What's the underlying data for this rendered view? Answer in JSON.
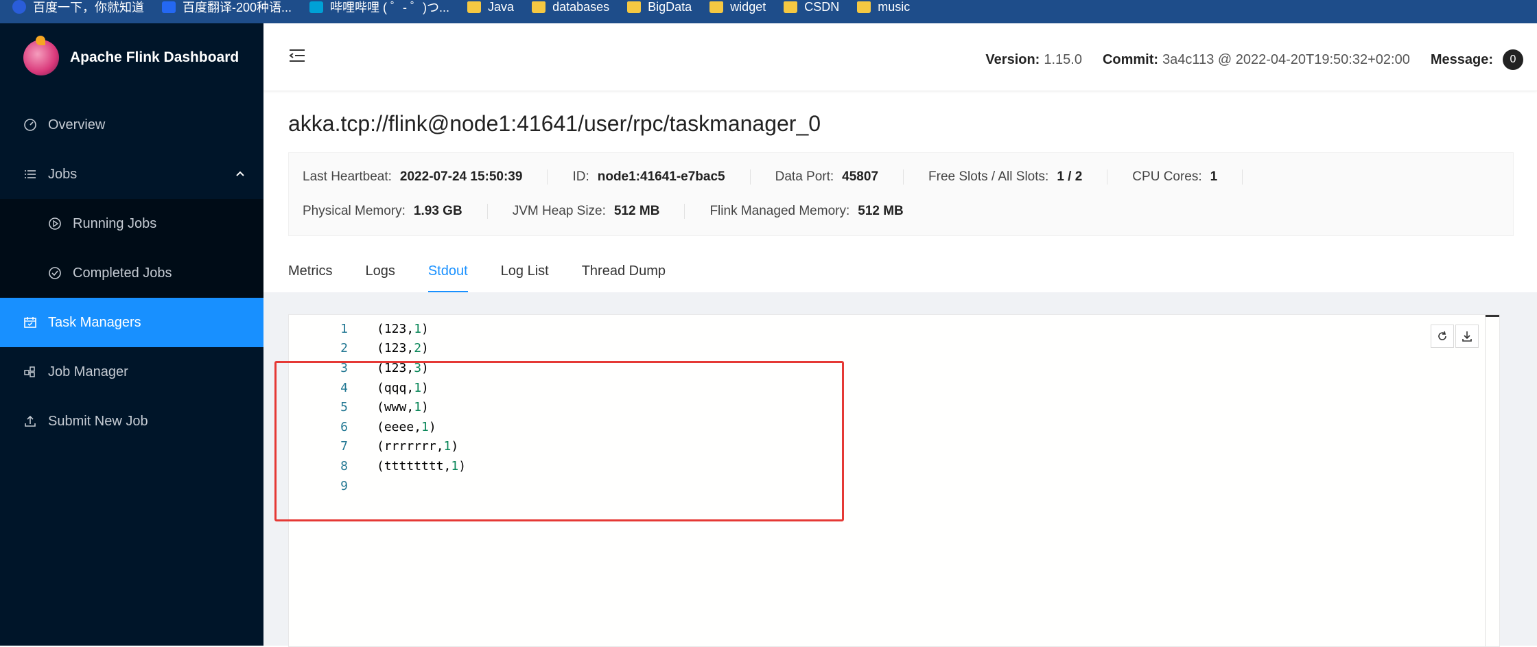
{
  "browser": {
    "bookmarks": [
      {
        "label": "百度一下，你就知道",
        "icon": "baidu-icon"
      },
      {
        "label": "百度翻译-200种语...",
        "icon": "translate-icon"
      },
      {
        "label": "哔哩哔哩 ( ゜- ゜)つ...",
        "icon": "bilibili-icon"
      },
      {
        "label": "Java",
        "icon": "folder-icon"
      },
      {
        "label": "databases",
        "icon": "folder-icon"
      },
      {
        "label": "BigData",
        "icon": "folder-icon"
      },
      {
        "label": "widget",
        "icon": "folder-icon"
      },
      {
        "label": "CSDN",
        "icon": "folder-icon"
      },
      {
        "label": "music",
        "icon": "folder-icon"
      }
    ]
  },
  "sidebar": {
    "brand": "Apache Flink Dashboard",
    "items": [
      {
        "label": "Overview",
        "icon": "dashboard-icon"
      },
      {
        "label": "Jobs",
        "icon": "list-icon"
      },
      {
        "label": "Running Jobs",
        "icon": "play-circle-icon"
      },
      {
        "label": "Completed Jobs",
        "icon": "check-circle-icon"
      },
      {
        "label": "Task Managers",
        "icon": "schedule-icon"
      },
      {
        "label": "Job Manager",
        "icon": "cluster-icon"
      },
      {
        "label": "Submit New Job",
        "icon": "upload-icon"
      }
    ]
  },
  "header": {
    "version_label": "Version:",
    "version": "1.15.0",
    "commit_label": "Commit:",
    "commit": "3a4c113 @ 2022-04-20T19:50:32+02:00",
    "message_label": "Message:",
    "message_count": "0"
  },
  "taskmanager": {
    "title": "akka.tcp://flink@node1:41641/user/rpc/taskmanager_0",
    "details": {
      "last_heartbeat_label": "Last Heartbeat:",
      "last_heartbeat": "2022-07-24 15:50:39",
      "id_label": "ID:",
      "id": "node1:41641-e7bac5",
      "data_port_label": "Data Port:",
      "data_port": "45807",
      "slots_label": "Free Slots / All Slots:",
      "slots": "1 / 2",
      "cpu_label": "CPU Cores:",
      "cpu": "1",
      "physical_memory_label": "Physical Memory:",
      "physical_memory": "1.93 GB",
      "jvm_heap_label": "JVM Heap Size:",
      "jvm_heap": "512 MB",
      "managed_memory_label": "Flink Managed Memory:",
      "managed_memory": "512 MB"
    }
  },
  "tabs": [
    {
      "label": "Metrics",
      "active": false
    },
    {
      "label": "Logs",
      "active": false
    },
    {
      "label": "Stdout",
      "active": true
    },
    {
      "label": "Log List",
      "active": false
    },
    {
      "label": "Thread Dump",
      "active": false
    }
  ],
  "stdout": {
    "lines": [
      {
        "n": "1",
        "word": "123",
        "count": "1"
      },
      {
        "n": "2",
        "word": "123",
        "count": "2"
      },
      {
        "n": "3",
        "word": "123",
        "count": "3"
      },
      {
        "n": "4",
        "word": "qqq",
        "count": "1"
      },
      {
        "n": "5",
        "word": "www",
        "count": "1"
      },
      {
        "n": "6",
        "word": "eeee",
        "count": "1"
      },
      {
        "n": "7",
        "word": "rrrrrrr",
        "count": "1"
      },
      {
        "n": "8",
        "word": "tttttttt",
        "count": "1"
      },
      {
        "n": "9",
        "word": "",
        "count": ""
      }
    ]
  },
  "colors": {
    "sidebar_bg": "#001529",
    "accent": "#1890ff",
    "highlight_box": "#e53935"
  }
}
